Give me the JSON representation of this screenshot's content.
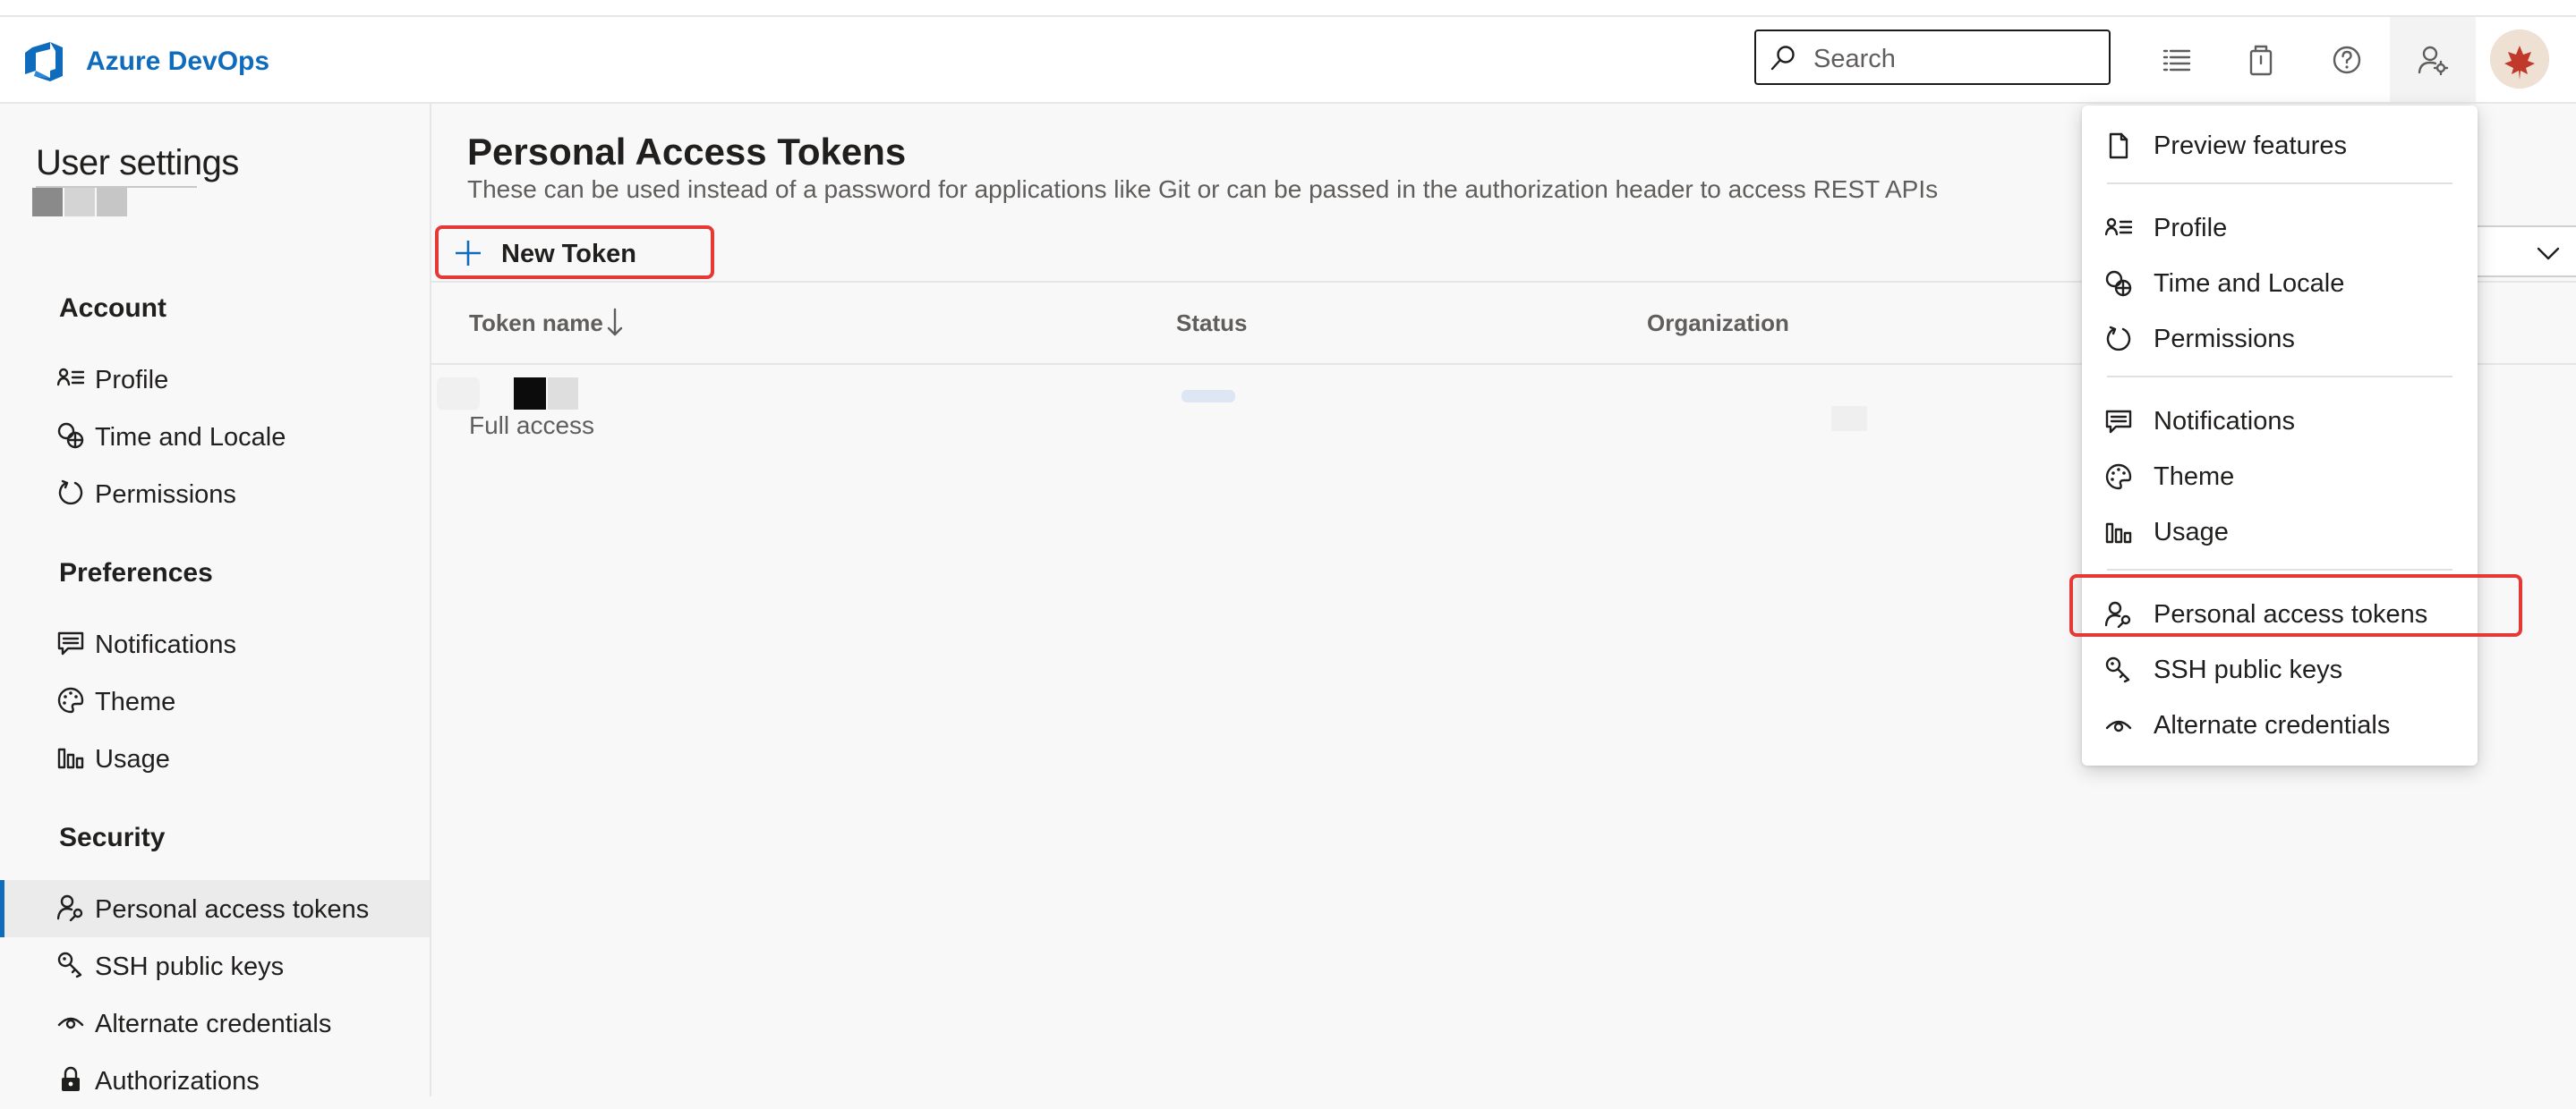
{
  "app": {
    "brand": "Azure DevOps",
    "accent": "#0f6cbd",
    "highlight": "#e53935"
  },
  "header": {
    "search_placeholder": "Search",
    "icons": [
      "work-items-icon",
      "marketplace-icon",
      "help-icon",
      "user-settings-icon",
      "avatar"
    ]
  },
  "sidebar": {
    "title": "User settings",
    "sections": [
      {
        "heading": "Account",
        "items": [
          {
            "label": "Profile",
            "icon": "profile-icon"
          },
          {
            "label": "Time and Locale",
            "icon": "globe-icon"
          },
          {
            "label": "Permissions",
            "icon": "permissions-icon"
          }
        ]
      },
      {
        "heading": "Preferences",
        "items": [
          {
            "label": "Notifications",
            "icon": "notifications-icon"
          },
          {
            "label": "Theme",
            "icon": "palette-icon"
          },
          {
            "label": "Usage",
            "icon": "usage-icon"
          }
        ]
      },
      {
        "heading": "Security",
        "items": [
          {
            "label": "Personal access tokens",
            "icon": "token-icon",
            "active": true
          },
          {
            "label": "SSH public keys",
            "icon": "key-icon"
          },
          {
            "label": "Alternate credentials",
            "icon": "eye-icon"
          },
          {
            "label": "Authorizations",
            "icon": "lock-icon"
          }
        ]
      }
    ]
  },
  "main": {
    "title": "Personal Access Tokens",
    "subtitle": "These can be used instead of a password for applications like Git or can be passed in the authorization header to access REST APIs",
    "new_token_label": "New Token",
    "columns": [
      "Token name",
      "Status",
      "Organization"
    ],
    "rows": [
      {
        "scope": "Full access"
      }
    ]
  },
  "menu": {
    "items": [
      {
        "label": "Preview features",
        "icon": "document-icon"
      },
      {
        "label": "Profile",
        "icon": "profile-icon"
      },
      {
        "label": "Time and Locale",
        "icon": "globe-icon"
      },
      {
        "label": "Permissions",
        "icon": "permissions-icon"
      },
      {
        "label": "Notifications",
        "icon": "notifications-icon"
      },
      {
        "label": "Theme",
        "icon": "palette-icon"
      },
      {
        "label": "Usage",
        "icon": "usage-icon"
      },
      {
        "label": "Personal access tokens",
        "icon": "token-icon",
        "highlighted": true
      },
      {
        "label": "SSH public keys",
        "icon": "key-icon"
      },
      {
        "label": "Alternate credentials",
        "icon": "eye-icon"
      }
    ]
  }
}
